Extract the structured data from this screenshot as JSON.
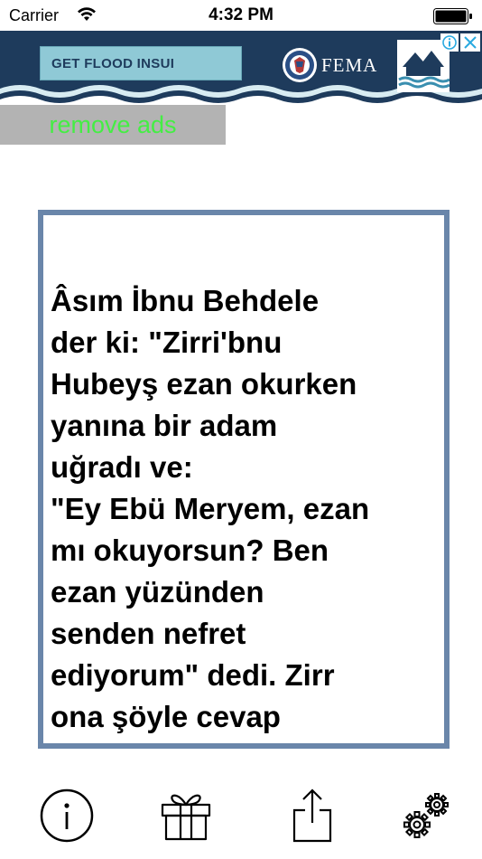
{
  "status_bar": {
    "carrier": "Carrier",
    "time": "4:32 PM"
  },
  "ad": {
    "cta_label": "GET FLOOD INSUI",
    "brand": "FEMA",
    "colors": {
      "background": "#1e3b5c",
      "cta": "#8fc9d6"
    }
  },
  "remove_ads": {
    "label": "remove ads",
    "text_color": "#44ee44",
    "background": "#b3b3b3"
  },
  "content": {
    "text": "Âsım İbnu Behdele\nder ki: \"Zirri'bnu\nHubeyş ezan okurken\nyanına bir adam\nuğradı ve:\n\"Ey Ebü Meryem, ezan\nmı okuyorsun? Ben\nezan yüzünden\nsenden nefret\nediyorum\" dedi. Zirr\nona şöyle cevap\nverdi:",
    "border_color": "#6a86aa"
  },
  "toolbar": {
    "items": [
      {
        "name": "info",
        "icon": "info-icon"
      },
      {
        "name": "gift",
        "icon": "gift-icon"
      },
      {
        "name": "share",
        "icon": "share-icon"
      },
      {
        "name": "settings",
        "icon": "gear-icon"
      }
    ]
  }
}
